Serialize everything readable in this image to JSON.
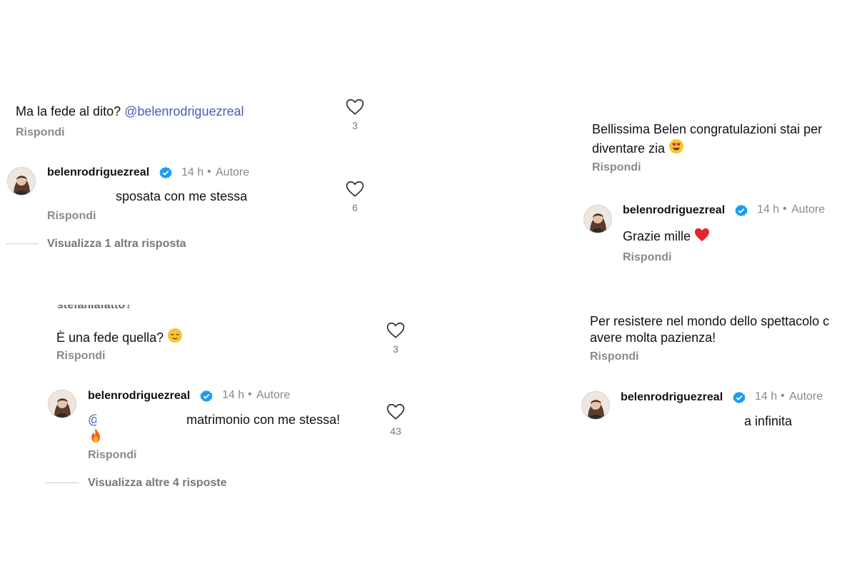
{
  "common": {
    "reply_label": "Rispondi",
    "time": "14 h",
    "author_tag": "Autore",
    "dot": "•",
    "colors": {
      "mention": "#4a5bb8",
      "badge": "#1d9bf0",
      "heart_red": "#e0272f"
    }
  },
  "panel_top_left": {
    "comment_text": "Ma la fede al dito? ",
    "comment_mention": "@belenrodriguezreal",
    "comment_likes": "3",
    "reply": {
      "username": "belenrodriguezreal",
      "text": "sposata con me stessa",
      "likes": "6"
    },
    "view_more": "Visualizza 1 altra risposta"
  },
  "panel_top_right": {
    "comment_line1": "Bellissima Belen congratulazioni stai per",
    "comment_line2": "diventare zia",
    "comment_emoji": "heart-eyes-emoji",
    "reply": {
      "username": "belenrodriguezreal",
      "text": "Grazie mille",
      "emoji": "red-heart-emoji"
    }
  },
  "panel_bottom_left": {
    "cut_header": "stefaniafatto?",
    "comment_text": "È una fede quella?",
    "comment_emoji": "relieved-face-emoji",
    "comment_likes": "3",
    "reply": {
      "username": "belenrodriguezreal",
      "mention_fragment": "@",
      "text": "matrimonio con me stessa!",
      "emoji": "fire-emoji",
      "likes": "43"
    },
    "view_more": "Visualizza altre 4 risposte"
  },
  "panel_bottom_right": {
    "comment_line1": "Per resistere nel mondo dello spettacolo c",
    "comment_line2": "avere molta pazienza!",
    "reply": {
      "username": "belenrodriguezreal",
      "text": "a infinita"
    }
  }
}
